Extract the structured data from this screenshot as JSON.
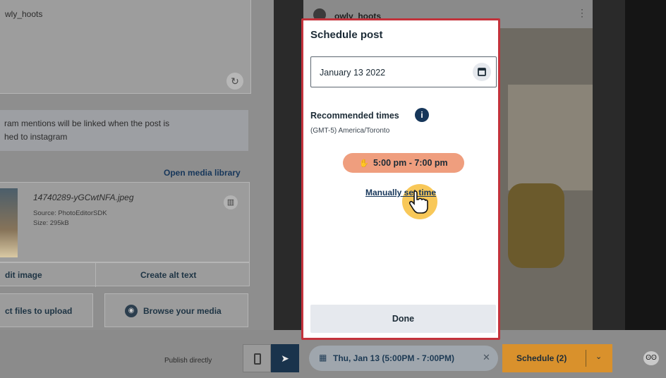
{
  "left_panel": {
    "profile_name": "wly_hoots",
    "notice_line1": "ram mentions will be linked when the post is",
    "notice_line2": "hed to instagram",
    "open_media_library": "Open media library",
    "file": {
      "name": "14740289-yGCwtNFA.jpeg",
      "source": "Source: PhotoEditorSDK",
      "size": "Size: 295kB"
    },
    "edit_image": "dit image",
    "create_alt_text": "Create alt text",
    "select_files": "ct files to upload",
    "browse_media": "Browse your media"
  },
  "preview": {
    "account_name": "owly_hoots"
  },
  "bottom_bar": {
    "publish_directly": "Publish directly",
    "schedule_chip": "Thu, Jan 13 (5:00PM - 7:00PM)",
    "schedule_button": "Schedule (2)"
  },
  "modal": {
    "title": "Schedule post",
    "date_value": "January 13 2022",
    "recommended_label": "Recommended times",
    "timezone": "(GMT-5) America/Toronto",
    "time_slot": "5:00 pm - 7:00 pm",
    "manual_link": "Manually set time",
    "done_button": "Done"
  },
  "colors": {
    "modal_border": "#c3323b",
    "slot_bg": "#ef9e7e",
    "schedule_button": "#d9912c",
    "navy": "#16365a"
  },
  "icons": [
    "calendar-icon",
    "info-icon",
    "clock-hand-icon",
    "pointer-hand-icon",
    "trash-icon",
    "refresh-icon",
    "mobile-icon",
    "send-icon",
    "chevron-down-icon",
    "close-icon",
    "owl-icon"
  ]
}
